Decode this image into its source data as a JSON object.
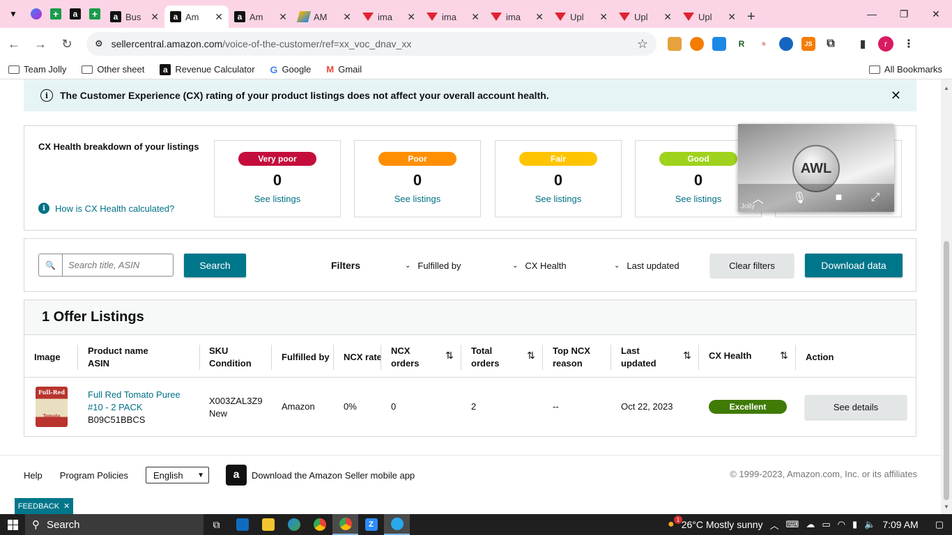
{
  "browser": {
    "tabs": [
      {
        "favicon": "messenger-icon",
        "title": "",
        "active": false
      },
      {
        "favicon": "sheets-icon",
        "title": "",
        "active": false
      },
      {
        "favicon": "amazon-icon",
        "title": "",
        "active": false
      },
      {
        "favicon": "sheets-icon",
        "title": "",
        "active": false
      },
      {
        "favicon": "amazon-icon",
        "title": "Bus",
        "active": false
      },
      {
        "favicon": "amazon-icon",
        "title": "Am",
        "active": true
      },
      {
        "favicon": "amazon-icon",
        "title": "Am",
        "active": false
      },
      {
        "favicon": "amzscout-icon",
        "title": "AM",
        "active": false
      },
      {
        "favicon": "vivaldi-icon",
        "title": "ima",
        "active": false
      },
      {
        "favicon": "vivaldi-icon",
        "title": "ima",
        "active": false
      },
      {
        "favicon": "vivaldi-icon",
        "title": "ima",
        "active": false
      },
      {
        "favicon": "vivaldi-icon",
        "title": "Upl",
        "active": false
      },
      {
        "favicon": "vivaldi-icon",
        "title": "Upl",
        "active": false
      },
      {
        "favicon": "vivaldi-icon",
        "title": "Upl",
        "active": false
      }
    ],
    "new_tab": "+",
    "url_host": "sellercentral.amazon.com",
    "url_path": "/voice-of-the-customer/ref=xx_voc_dnav_xx",
    "profile_initial": "r",
    "bookmarks": [
      "Team Jolly",
      "Other sheet",
      "Revenue Calculator",
      "Google",
      "Gmail"
    ],
    "all_bookmarks": "All Bookmarks"
  },
  "banner": {
    "text": "The Customer Experience (CX) rating of your product listings does not affect your overall account health."
  },
  "health": {
    "title": "CX Health breakdown of your listings",
    "link": "How is CX Health calculated?",
    "cards": [
      {
        "label": "Very poor",
        "count": "0",
        "link": "See listings",
        "color": "#c40d3c",
        "text_color": "#ffffff"
      },
      {
        "label": "Poor",
        "count": "0",
        "link": "See listings",
        "color": "#ff8f00",
        "text_color": "#ffffff"
      },
      {
        "label": "Fair",
        "count": "0",
        "link": "See listings",
        "color": "#ffc400",
        "text_color": "#ffffff"
      },
      {
        "label": "Good",
        "count": "0",
        "link": "See listings",
        "color": "#9fd21d",
        "text_color": "#ffffff"
      }
    ]
  },
  "video_overlay": {
    "name": "Jolly",
    "logo_text": "AWL"
  },
  "filters": {
    "search_placeholder": "Search title, ASIN",
    "search_button": "Search",
    "label": "Filters",
    "dropdowns": [
      "Fulfilled by",
      "CX Health",
      "Last updated"
    ],
    "clear_button": "Clear filters",
    "download_button": "Download data"
  },
  "listings": {
    "heading": "1 Offer Listings",
    "columns": {
      "image": "Image",
      "product_1": "Product name",
      "product_2": "ASIN",
      "sku_1": "SKU",
      "sku_2": "Condition",
      "fulfilled": "Fulfilled by",
      "ncx_rate": "NCX rate",
      "ncx_orders_1": "NCX",
      "ncx_orders_2": "orders",
      "total_1": "Total",
      "total_2": "orders",
      "top_1": "Top NCX",
      "top_2": "reason",
      "last_1": "Last",
      "last_2": "updated",
      "cx_health": "CX Health",
      "action": "Action"
    },
    "rows": [
      {
        "image_text_1": "Full-Red",
        "image_text_2": "Tomato Puree",
        "name_1": "Full Red Tomato Puree",
        "name_2": "#10 - 2 PACK",
        "asin": "B09C51BBCS",
        "sku": "X003ZAL3Z9",
        "condition": "New",
        "fulfilled": "Amazon",
        "ncx_rate": "0%",
        "ncx_orders": "0",
        "total_orders": "2",
        "top_reason": "--",
        "last_updated": "Oct 22, 2023",
        "cx_health": "Excellent",
        "action": "See details"
      }
    ]
  },
  "footer": {
    "help": "Help",
    "policies": "Program Policies",
    "language": "English",
    "app_text": "Download the Amazon Seller mobile app",
    "copyright": "© 1999-2023, Amazon.com, Inc. or its affiliates",
    "feedback": "FEEDBACK"
  },
  "taskbar": {
    "search": "Search",
    "weather": "26°C  Mostly sunny",
    "time": "7:09 AM",
    "weather_badge": "1"
  }
}
